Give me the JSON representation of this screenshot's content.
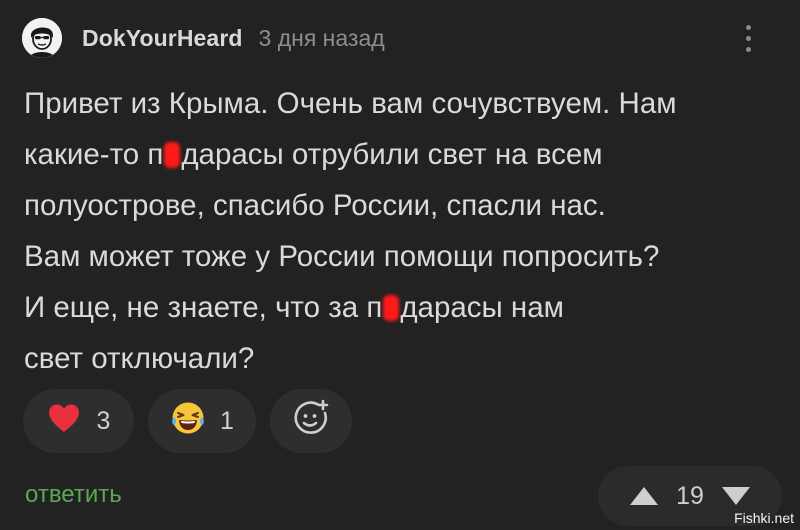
{
  "comment": {
    "username": "DokYourHeard",
    "time": "3 дня назад",
    "lines": [
      {
        "before": "Привет из Крыма. Очень вам сочувствуем. Нам",
        "censored": false,
        "after": ""
      },
      {
        "before": "какие-то п",
        "censored": true,
        "after": "дарасы отрубили свет на всем"
      },
      {
        "before": "полуострове, спасибо России, спасли нас.",
        "censored": false,
        "after": ""
      },
      {
        "before": "Вам может тоже у России помощи попросить?",
        "censored": false,
        "after": ""
      },
      {
        "before": "И еще, не знаете, что за п",
        "censored": true,
        "after": "дарасы нам"
      },
      {
        "before": "свет отключали?",
        "censored": false,
        "after": ""
      }
    ],
    "censor_color": "#ff1a1a"
  },
  "reactions": [
    {
      "icon": "heart-icon",
      "count": "3",
      "color": "#e8303f"
    },
    {
      "icon": "laughing-emoji-icon",
      "count": "1",
      "color": "#f7c53a"
    },
    {
      "icon": "add-reaction-icon",
      "count": ""
    }
  ],
  "actions": {
    "reply_label": "ответить",
    "reply_color": "#5aa854"
  },
  "votes": {
    "score": "19",
    "up_icon": "triangle-up-icon",
    "down_icon": "triangle-down-icon"
  },
  "watermark": "Fishki.net"
}
